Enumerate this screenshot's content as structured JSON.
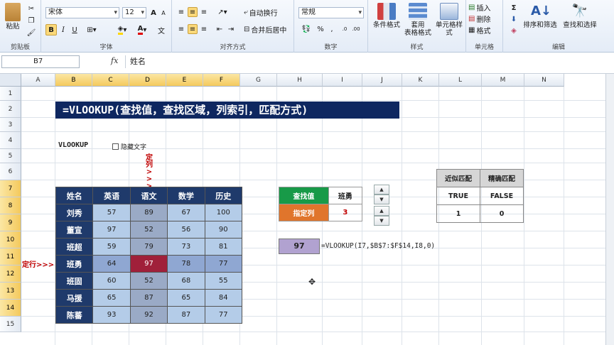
{
  "ribbon": {
    "clipboard": {
      "paste_label": "粘贴",
      "group_label": "剪贴板"
    },
    "font": {
      "font_name": "宋体",
      "font_size": "12",
      "bold": "B",
      "italic": "I",
      "underline": "U",
      "group_label": "字体"
    },
    "alignment": {
      "wrap_text": "自动换行",
      "merge_center": "合并后居中",
      "group_label": "对齐方式"
    },
    "number": {
      "format": "常规",
      "percent": "%",
      "comma": ",",
      "group_label": "数字"
    },
    "styles": {
      "conditional": "条件格式",
      "table_format_line1": "套用",
      "table_format_line2": "表格格式",
      "cell_styles": "单元格样式",
      "group_label": "样式"
    },
    "cells": {
      "insert": "插入",
      "delete": "删除",
      "format": "格式",
      "group_label": "单元格"
    },
    "editing": {
      "sum": "Σ",
      "sort_filter": "排序和筛选",
      "find_select": "查找和选择",
      "group_label": "编辑"
    }
  },
  "formula_bar": {
    "name_box": "B7",
    "fx": "fx",
    "content": "姓名"
  },
  "columns": [
    "A",
    "B",
    "C",
    "D",
    "E",
    "F",
    "G",
    "H",
    "I",
    "J",
    "K",
    "L",
    "M",
    "N"
  ],
  "rows": [
    "1",
    "2",
    "3",
    "4",
    "5",
    "6",
    "7",
    "8",
    "9",
    "10",
    "11",
    "12",
    "13",
    "14",
    "15"
  ],
  "sheet": {
    "title": "=VLOOKUP(查找值，查找区域，列索引，匹配方式)",
    "vlookup_label": "VLOOKUP",
    "checkbox_label": "隐藏文字",
    "row_marker": "定行>>>",
    "col_marker_chars": [
      "定",
      "列",
      ">",
      ">",
      ">"
    ],
    "score_table": {
      "headers": [
        "姓名",
        "英语",
        "语文",
        "数学",
        "历史"
      ],
      "rows": [
        [
          "刘秀",
          "57",
          "89",
          "67",
          "100"
        ],
        [
          "董宣",
          "97",
          "52",
          "56",
          "90"
        ],
        [
          "班超",
          "59",
          "79",
          "73",
          "81"
        ],
        [
          "班勇",
          "64",
          "97",
          "78",
          "77"
        ],
        [
          "班固",
          "60",
          "52",
          "68",
          "55"
        ],
        [
          "马援",
          "65",
          "87",
          "65",
          "84"
        ],
        [
          "陈蕃",
          "93",
          "92",
          "87",
          "77"
        ]
      ]
    },
    "lookup": {
      "label_value": "查找值",
      "value": "班勇",
      "label_col": "指定列",
      "col": "3"
    },
    "result": "97",
    "result_formula": "=VLOOKUP(I7,$B$7:$F$14,I8,0)",
    "match_table": {
      "headers": [
        "近似匹配",
        "精确匹配"
      ],
      "row1": [
        "TRUE",
        "FALSE"
      ],
      "row2": [
        "1",
        "0"
      ]
    }
  },
  "colors": {
    "title_bg": "#0e2760",
    "header_bg": "#1f3a6b",
    "lookup_green": "#189a48",
    "lookup_orange": "#e0752c",
    "highlight": "#a0203a",
    "result_bg": "#b1a2d0"
  }
}
